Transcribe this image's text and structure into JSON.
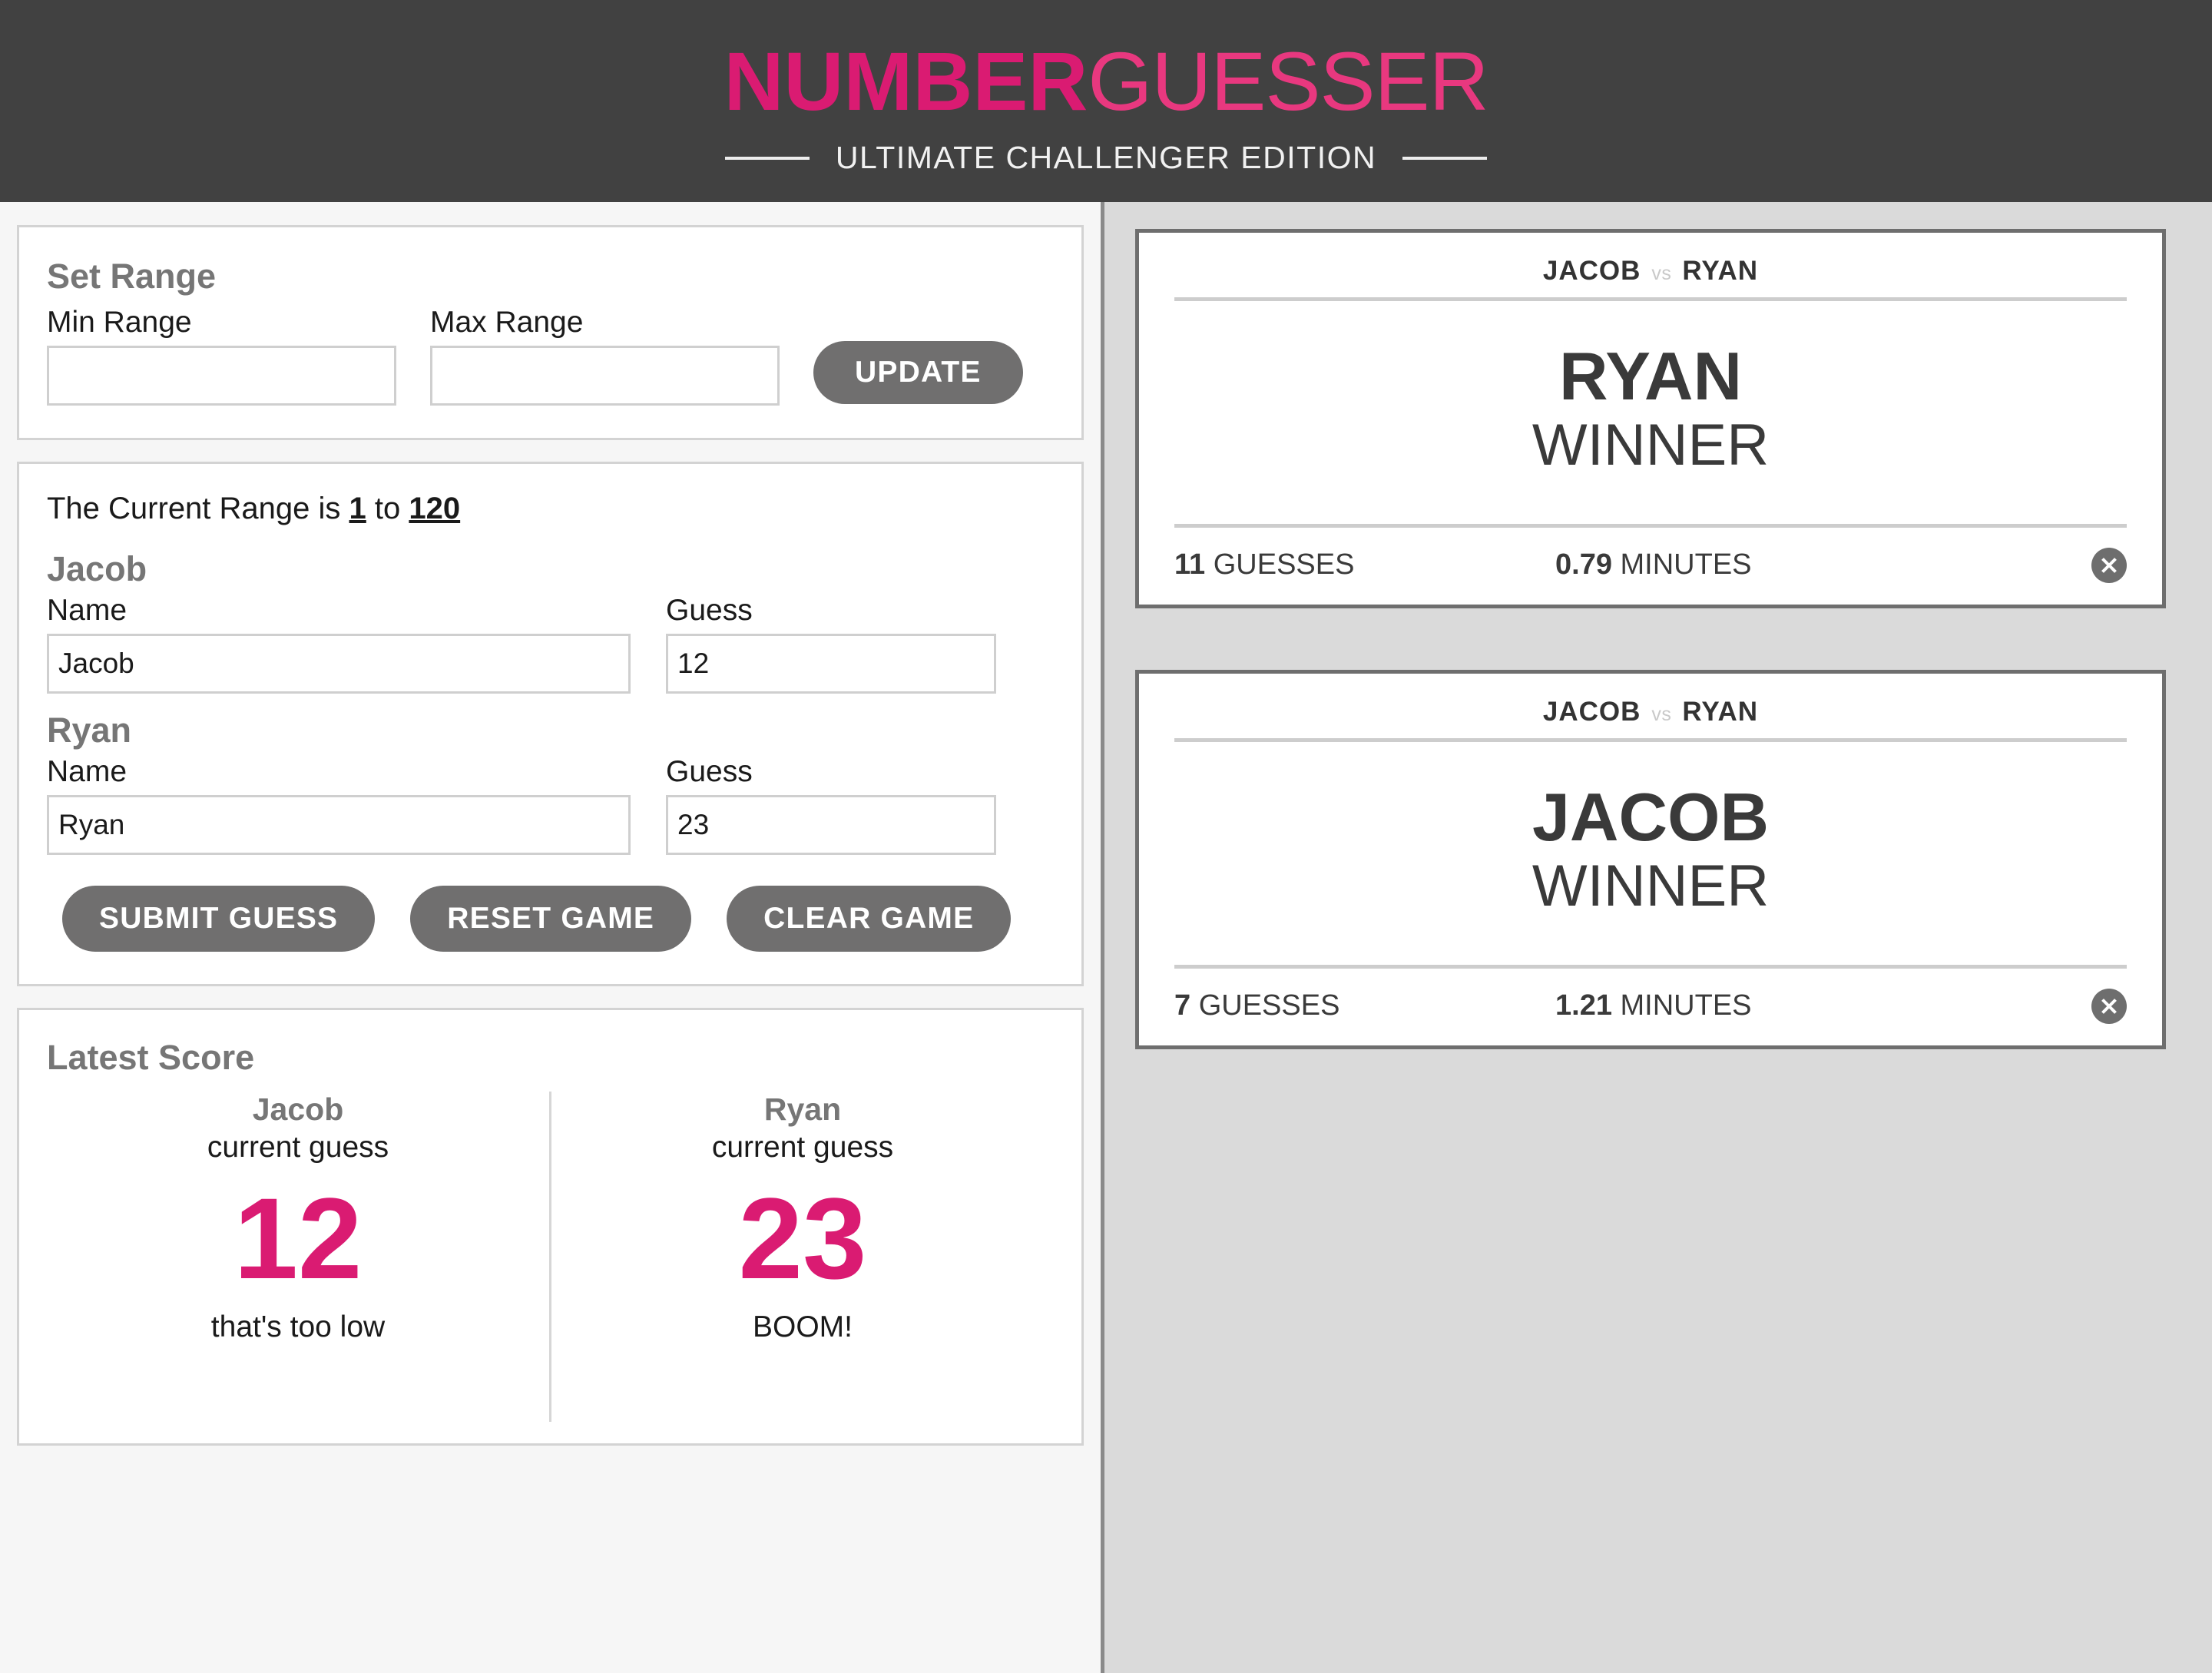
{
  "header": {
    "logo_bold": "NUMBER",
    "logo_light": "GUESSER",
    "subtitle": "ULTIMATE CHALLENGER EDITION"
  },
  "set_range": {
    "title": "Set Range",
    "min_label": "Min Range",
    "min_value": "",
    "min_placeholder": "",
    "max_label": "Max Range",
    "max_value": "",
    "max_placeholder": "",
    "update_button": "UPDATE"
  },
  "game": {
    "range_prefix": "The Current Range is",
    "range_min": "1",
    "range_joiner": "to",
    "range_max": "120",
    "name_label": "Name",
    "guess_label": "Guess",
    "players": [
      {
        "heading": "Jacob",
        "name_value": "Jacob",
        "guess_value": "12"
      },
      {
        "heading": "Ryan",
        "name_value": "Ryan",
        "guess_value": "23"
      }
    ],
    "buttons": {
      "submit": "SUBMIT GUESS",
      "reset": "RESET GAME",
      "clear": "CLEAR GAME"
    }
  },
  "latest_score": {
    "title": "Latest Score",
    "columns": [
      {
        "player": "Jacob",
        "caption": "current guess",
        "value": "12",
        "hint": "that's too low"
      },
      {
        "player": "Ryan",
        "caption": "current guess",
        "value": "23",
        "hint": "BOOM!"
      }
    ]
  },
  "winner_cards": [
    {
      "player_one": "JACOB",
      "vs": "vs",
      "player_two": "RYAN",
      "winner_name": "RYAN",
      "winner_label": "WINNER",
      "guesses_value": "11",
      "guesses_label": "GUESSES",
      "minutes_value": "0.79",
      "minutes_label": "MINUTES",
      "close_icon": "close-icon"
    },
    {
      "player_one": "JACOB",
      "vs": "vs",
      "player_two": "RYAN",
      "winner_name": "JACOB",
      "winner_label": "WINNER",
      "guesses_value": "7",
      "guesses_label": "GUESSES",
      "minutes_value": "1.21",
      "minutes_label": "MINUTES",
      "close_icon": "close-icon"
    }
  ],
  "colors": {
    "accent_pink": "#da1b72",
    "header_bg": "#414141",
    "button_gray": "#706f6f",
    "right_panel_bg": "#dadada"
  }
}
